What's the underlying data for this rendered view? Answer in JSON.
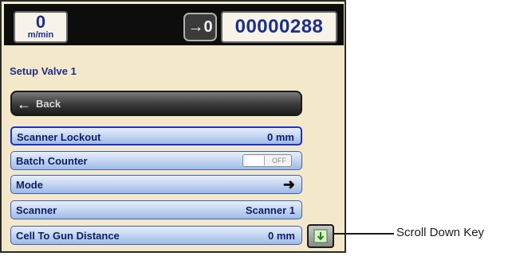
{
  "header": {
    "speed_value": "0",
    "speed_unit": "m/min",
    "io_button_label": "→0",
    "counter_value": "00000288"
  },
  "section_title": "Setup Valve 1",
  "back_button": {
    "label": "Back"
  },
  "rows": [
    {
      "label": "Scanner Lockout",
      "value": "0 mm"
    },
    {
      "label": "Batch Counter",
      "toggle": "OFF"
    },
    {
      "label": "Mode"
    },
    {
      "label": "Scanner",
      "value": "Scanner 1"
    },
    {
      "label": "Cell To Gun Distance",
      "value": "0 mm"
    }
  ],
  "callout": {
    "label": "Scroll Down Key"
  }
}
